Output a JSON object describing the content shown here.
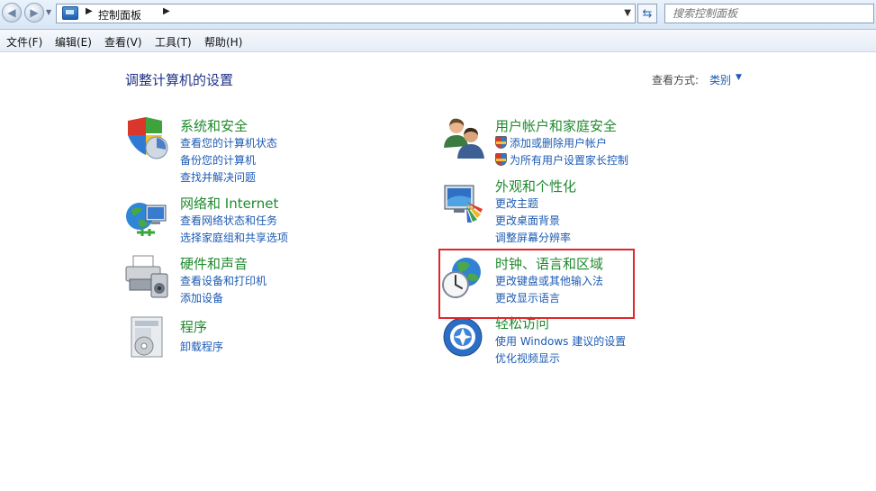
{
  "breadcrumb": {
    "root": "控制面板"
  },
  "search": {
    "placeholder": "搜索控制面板"
  },
  "menu": {
    "file": "文件(F)",
    "edit": "编辑(E)",
    "view": "查看(V)",
    "tools": "工具(T)",
    "help": "帮助(H)"
  },
  "page": {
    "title": "调整计算机的设置",
    "view_by_label": "查看方式:",
    "view_by_value": "类别"
  },
  "categories": {
    "system": {
      "title": "系统和安全",
      "links": [
        "查看您的计算机状态",
        "备份您的计算机",
        "查找并解决问题"
      ],
      "icon": "security-shield-icon"
    },
    "network": {
      "title": "网络和 Internet",
      "links": [
        "查看网络状态和任务",
        "选择家庭组和共享选项"
      ],
      "icon": "network-globe-icon"
    },
    "hardware": {
      "title": "硬件和声音",
      "links": [
        "查看设备和打印机",
        "添加设备"
      ],
      "icon": "printer-icon"
    },
    "programs": {
      "title": "程序",
      "links": [
        "卸载程序"
      ],
      "icon": "programs-icon"
    },
    "users": {
      "title": "用户帐户和家庭安全",
      "links": [
        "添加或删除用户帐户",
        "为所有用户设置家长控制"
      ],
      "icon": "users-icon"
    },
    "appearance": {
      "title": "外观和个性化",
      "links": [
        "更改主题",
        "更改桌面背景",
        "调整屏幕分辨率"
      ],
      "icon": "appearance-monitor-icon"
    },
    "clock": {
      "title": "时钟、语言和区域",
      "links": [
        "更改键盘或其他输入法",
        "更改显示语言"
      ],
      "icon": "clock-globe-icon"
    },
    "ease": {
      "title": "轻松访问",
      "links": [
        "使用 Windows 建议的设置",
        "优化视频显示"
      ],
      "icon": "ease-of-access-icon"
    }
  },
  "colors": {
    "category_title": "#1f8a2e",
    "link": "#1c5bb3",
    "heading": "#1e3287",
    "highlight": "#e0262b"
  }
}
